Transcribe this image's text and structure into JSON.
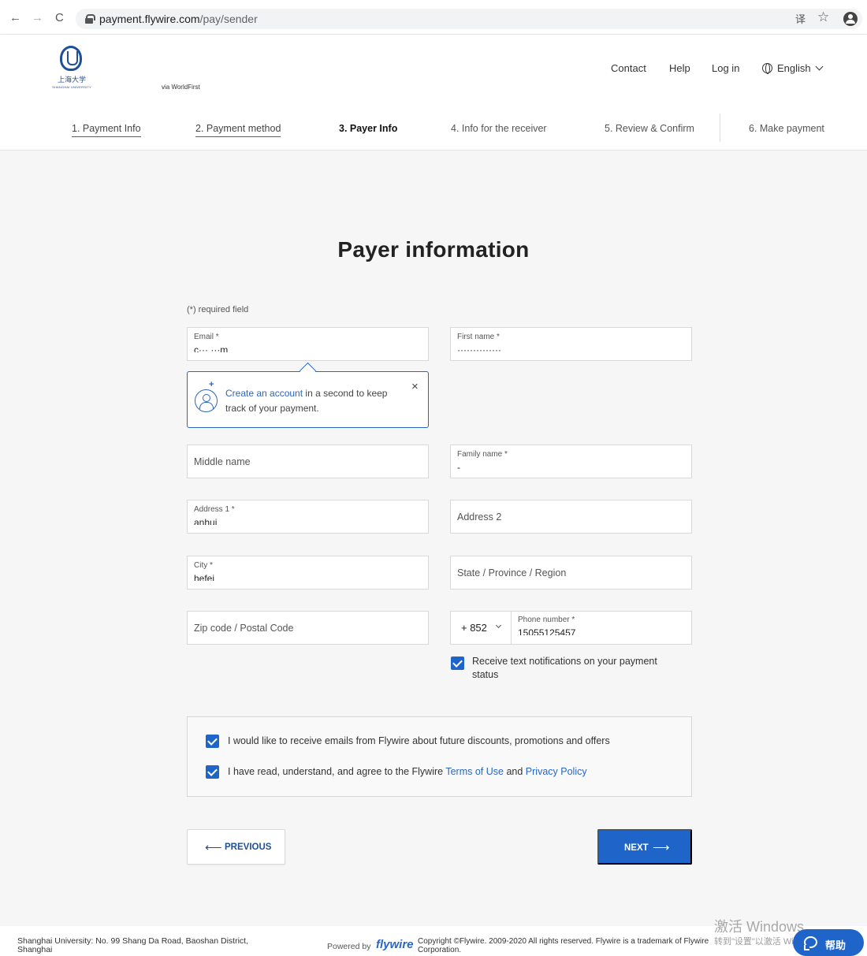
{
  "browser": {
    "url_host": "payment.flywire.com",
    "url_path": "/pay/sender"
  },
  "header": {
    "logo_cn": "上海大学",
    "logo_en": "SHANGHAI UNIVERSITY",
    "via": "via WorldFirst",
    "nav": {
      "contact": "Contact",
      "help": "Help",
      "login": "Log in",
      "language": "English"
    }
  },
  "steps": [
    {
      "label": "1. Payment Info",
      "state": "done"
    },
    {
      "label": "2. Payment method",
      "state": "done"
    },
    {
      "label": "3. Payer Info",
      "state": "current"
    },
    {
      "label": "4. Info for the receiver",
      "state": "todo"
    },
    {
      "label": "5. Review & Confirm",
      "state": "todo"
    },
    {
      "label": "6. Make payment",
      "state": "todo"
    }
  ],
  "form": {
    "title": "Payer information",
    "required_note": "(*) required field",
    "email": {
      "label": "Email *",
      "value": "c··· ···m"
    },
    "first_name": {
      "label": "First name *",
      "value": "··············"
    },
    "create_account": {
      "link": "Create an account",
      "text": " in a second to keep track of your payment.",
      "close": "×"
    },
    "middle_name": {
      "placeholder": "Middle name"
    },
    "family_name": {
      "label": "Family name *",
      "value": "-"
    },
    "address1": {
      "label": "Address 1 *",
      "value": "anhui"
    },
    "address2": {
      "placeholder": "Address 2"
    },
    "city": {
      "label": "City *",
      "value": "hefei"
    },
    "state": {
      "placeholder": "State / Province / Region"
    },
    "zip": {
      "placeholder": "Zip code / Postal Code"
    },
    "phone_prefix": "+ 852",
    "phone": {
      "label": "Phone number *",
      "value": "15055125457"
    },
    "sms_notifications": {
      "checked": true,
      "label": "Receive text notifications on your payment status"
    },
    "consent_emails": {
      "checked": true,
      "label": "I would like to receive emails from Flywire about future discounts, promotions and offers"
    },
    "consent_terms": {
      "checked": true,
      "prefix": "I have read, understand, and agree to the Flywire ",
      "terms": "Terms of Use",
      "and": " and ",
      "privacy": "Privacy Policy"
    },
    "previous": "PREVIOUS",
    "next": "NEXT"
  },
  "footer": {
    "address": "Shanghai University: No. 99 Shang Da Road, Baoshan District, Shanghai",
    "powered_by": "Powered by",
    "brand": "flywire",
    "copyright": "Copyright ©Flywire. 2009-2020 All rights reserved. Flywire is a trademark of Flywire Corporation."
  },
  "overlay": {
    "watermark_title": "激活 Windows",
    "watermark_sub": "转到\"设置\"以激活 Windows。",
    "help_label": "帮助"
  },
  "colors": {
    "accent": "#1f64c8",
    "link": "#2a66c4",
    "step_done_underline": "#2e7d32"
  }
}
